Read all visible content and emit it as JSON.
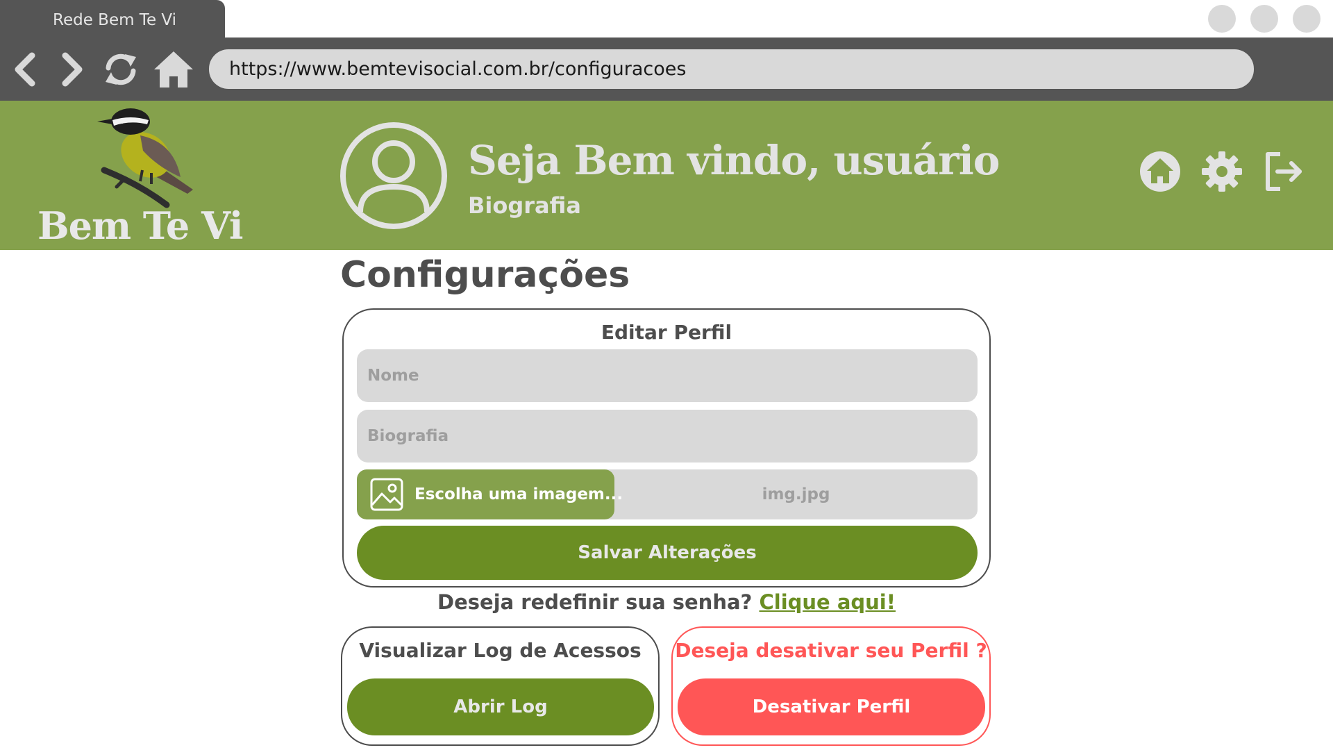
{
  "browser": {
    "tab_title": "Rede Bem Te Vi",
    "url": "https://www.bemtevisocial.com.br/configuracoes",
    "nav_icons": [
      "back-icon",
      "forward-icon",
      "reload-icon",
      "home-icon"
    ]
  },
  "header": {
    "logo_text": "Bem Te Vi",
    "welcome": "Seja Bem vindo, usuário",
    "bio": "Biografia",
    "icons": [
      "home-icon",
      "gear-icon",
      "logout-icon"
    ]
  },
  "page": {
    "title": "Configurações"
  },
  "edit_profile": {
    "title": "Editar Perfil",
    "name_placeholder": "Nome",
    "bio_placeholder": "Biografia",
    "file_button_label": "Escolha uma imagem...",
    "file_name": "img.jpg",
    "save_label": "Salvar Alterações"
  },
  "password": {
    "question": "Deseja redefinir sua senha?",
    "link": "Clique aqui!"
  },
  "log": {
    "title": "Visualizar Log de Acessos",
    "button": "Abrir Log"
  },
  "deactivate": {
    "title": "Deseja desativar seu Perfil ?",
    "button": "Desativar Perfil"
  },
  "colors": {
    "brand_green": "#85a14c",
    "button_green": "#6b8e23",
    "danger_red": "#ff5656",
    "chrome_gray": "#555555"
  }
}
